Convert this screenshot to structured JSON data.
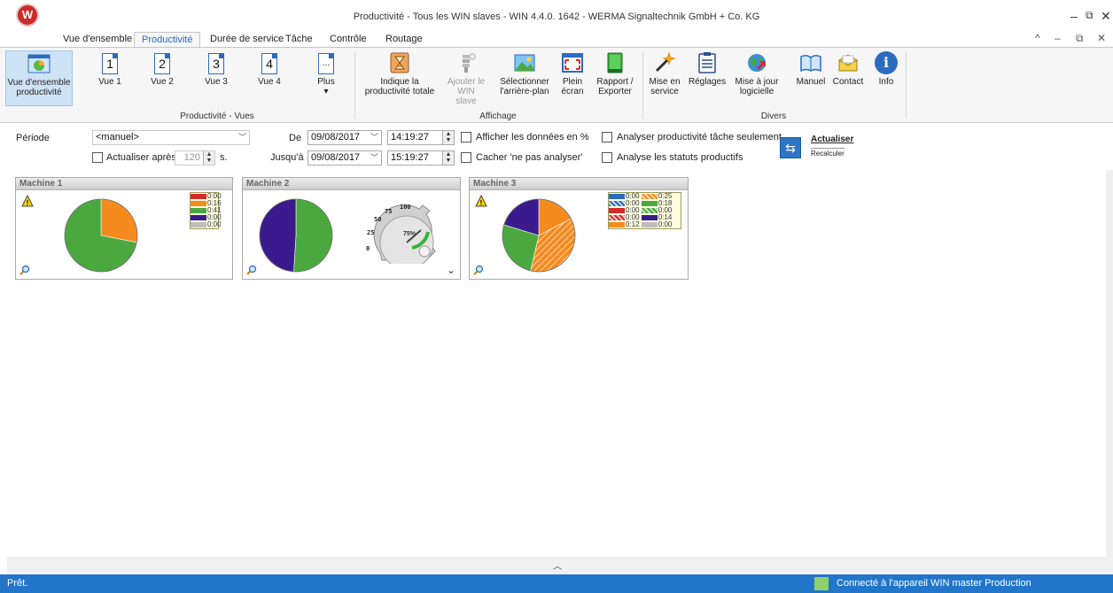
{
  "window": {
    "title": "Productivité - Tous les WIN slaves - WIN 4.4.0. 1642 - WERMA Signaltechnik GmbH + Co. KG",
    "logo": "W",
    "controls": [
      "–",
      "⧉",
      "✕"
    ],
    "mdi_controls": [
      "^",
      "–",
      "⧉",
      "✕"
    ]
  },
  "tabs": [
    {
      "label": "Vue d'ensemble"
    },
    {
      "label": "Productivité"
    },
    {
      "label": "Durée de service"
    },
    {
      "label": "Tâche"
    },
    {
      "label": "Contrôle"
    },
    {
      "label": "Routage"
    }
  ],
  "ribbon": {
    "buttons": [
      {
        "label": "Vue d'ensemble productivité",
        "icon": "overview-icon"
      },
      {
        "label": "Vue 1",
        "icon": "page-1-icon",
        "num": "1"
      },
      {
        "label": "Vue 2",
        "icon": "page-2-icon",
        "num": "2"
      },
      {
        "label": "Vue 3",
        "icon": "page-3-icon",
        "num": "3"
      },
      {
        "label": "Vue 4",
        "icon": "page-4-icon",
        "num": "4"
      },
      {
        "label": "Plus",
        "icon": "more-icon",
        "num": "...",
        "arrow": "▾"
      },
      {
        "label": "Indique la productivité totale",
        "icon": "hourglass-icon"
      },
      {
        "label": "Ajouter le WIN slave",
        "icon": "add-slave-icon"
      },
      {
        "label": "Sélectionner l'arrière-plan",
        "icon": "background-image-icon"
      },
      {
        "label": "Plein écran",
        "icon": "fullscreen-icon"
      },
      {
        "label": "Rapport / Exporter",
        "icon": "report-book-icon"
      },
      {
        "label": "Mise en service",
        "icon": "magic-wand-icon"
      },
      {
        "label": "Réglages",
        "icon": "settings-list-icon"
      },
      {
        "label": "Mise à jour logicielle",
        "icon": "globe-update-icon"
      },
      {
        "label": "Manuel",
        "icon": "manual-book-icon"
      },
      {
        "label": "Contact",
        "icon": "envelope-icon"
      },
      {
        "label": "Info",
        "icon": "info-icon",
        "glyph": "i"
      }
    ],
    "groups": [
      "Productivité - Vues",
      "Affichage",
      "Divers"
    ]
  },
  "filters": {
    "periode_label": "Période",
    "periode_value": "<manuel>",
    "actualiser_apres_label": "Actualiser après",
    "actualiser_value": "120",
    "seconds_unit": "s.",
    "de_label": "De",
    "de_date": "09/08/2017",
    "de_time": "14:19:27",
    "jusqua_label": "Jusqu'à",
    "jusqua_date": "09/08/2017",
    "jusqua_time": "15:19:27",
    "afficher_pct": "Afficher les données en %",
    "cacher": "Cacher 'ne pas analyser'",
    "analyser_tache": "Analyser productivité tâche seulement",
    "analyse_statuts": "Analyse les statuts productifs",
    "actualiser_btn": "Actualiser",
    "recalculer": "Recalculer"
  },
  "machines": [
    {
      "title": "Machine 1",
      "legend": [
        "0:00",
        "0:16",
        "0:41",
        "0:00",
        "0:00"
      ],
      "legend_colors": [
        "#d42a2a",
        "#f58b1f",
        "#4aa83f",
        "#3a1a8c",
        "#bdbdbd"
      ],
      "pie": [
        {
          "color": "#f58b1f",
          "value": 16
        },
        {
          "color": "#4aa83f",
          "value": 41
        }
      ]
    },
    {
      "title": "Machine 2",
      "gauge_ticks": [
        "100",
        "75",
        "50",
        "25",
        "0"
      ],
      "gauge_value": "75%",
      "pie": [
        {
          "color": "#4aa83f",
          "value": 51
        },
        {
          "color": "#3a1a8c",
          "value": 49
        }
      ]
    },
    {
      "title": "Machine 3",
      "legend_left": [
        "0:00",
        "0:00",
        "0:00",
        "0:00",
        "0:12"
      ],
      "legend_right": [
        "0:25",
        "0:18",
        "0:00",
        "0:14",
        "0:00"
      ],
      "pie": [
        {
          "color": "#f58b1f",
          "value": 12
        },
        {
          "color": "#f58b1f",
          "value": 25,
          "hatched": true
        },
        {
          "color": "#4aa83f",
          "value": 18
        },
        {
          "color": "#3a1a8c",
          "value": 14
        }
      ]
    }
  ],
  "status": {
    "ready": "Prêt.",
    "connection": "Connecté à l'appareil WIN master Production"
  }
}
